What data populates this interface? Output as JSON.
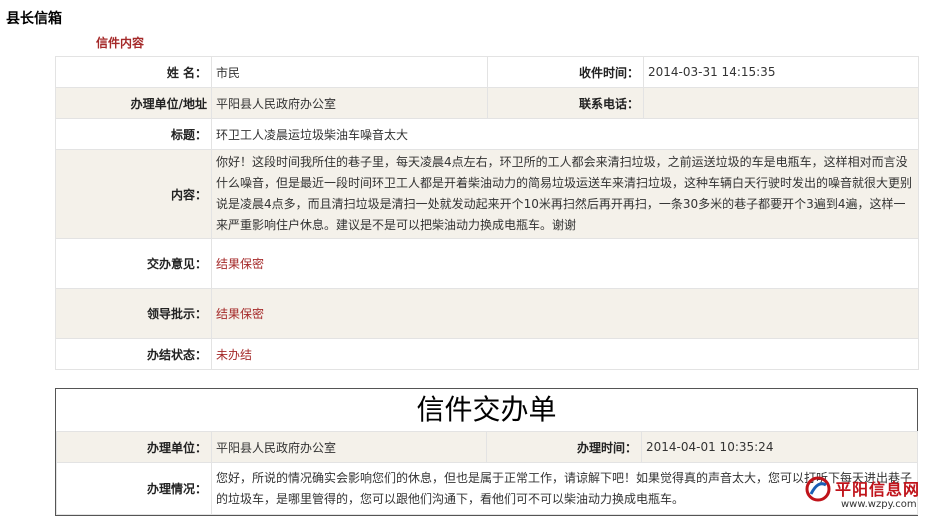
{
  "page_title": "县长信箱",
  "section_title": "信件内容",
  "info": {
    "name_label": "姓 名：",
    "name_value": "市民",
    "recv_time_label": "收件时间：",
    "recv_time_value": "2014-03-31 14:15:35",
    "unit_label": "办理单位/地址",
    "unit_value": "平阳县人民政府办公室",
    "phone_label": "联系电话：",
    "phone_value": "",
    "subject_label": "标题：",
    "subject_value": "环卫工人凌晨运垃圾柴油车噪音太大",
    "content_label": "内容：",
    "content_value": "你好！这段时间我所住的巷子里，每天凌晨4点左右，环卫所的工人都会来清扫垃圾，之前运送垃圾的车是电瓶车，这样相对而言没什么噪音，但是最近一段时间环卫工人都是开着柴油动力的简易垃圾运送车来清扫垃圾，这种车辆白天行驶时发出的噪音就很大更别说是凌晨4点多，而且清扫垃圾是清扫一处就发动起来开个10米再扫然后再开再扫，一条30多米的巷子都要开个3遍到4遍，这样一来严重影响住户休息。建议是不是可以把柴油动力换成电瓶车。谢谢",
    "opinion_label": "交办意见：",
    "opinion_value": "结果保密",
    "leader_label": "领导批示：",
    "leader_value": "结果保密",
    "status_label": "办结状态：",
    "status_value": "未办结"
  },
  "handling": {
    "heading": "信件交办单",
    "unit_label": "办理单位：",
    "unit_value": "平阳县人民政府办公室",
    "time_label": "办理时间：",
    "time_value": "2014-04-01 10:35:24",
    "situation_label": "办理情况：",
    "situation_value": "您好，所说的情况确实会影响您们的休息，但也是属于正常工作，请谅解下吧！如果觉得真的声音太大，您可以打听下每天进出巷子的垃圾车，是哪里管得的，您可以跟他们沟通下，看他们可不可以柴油动力换成电瓶车。"
  },
  "watermark": {
    "name": "平阳信息网",
    "url": "www.wzpy.com",
    "icon": "site-logo-icon",
    "brand_color": "#c0131a"
  }
}
